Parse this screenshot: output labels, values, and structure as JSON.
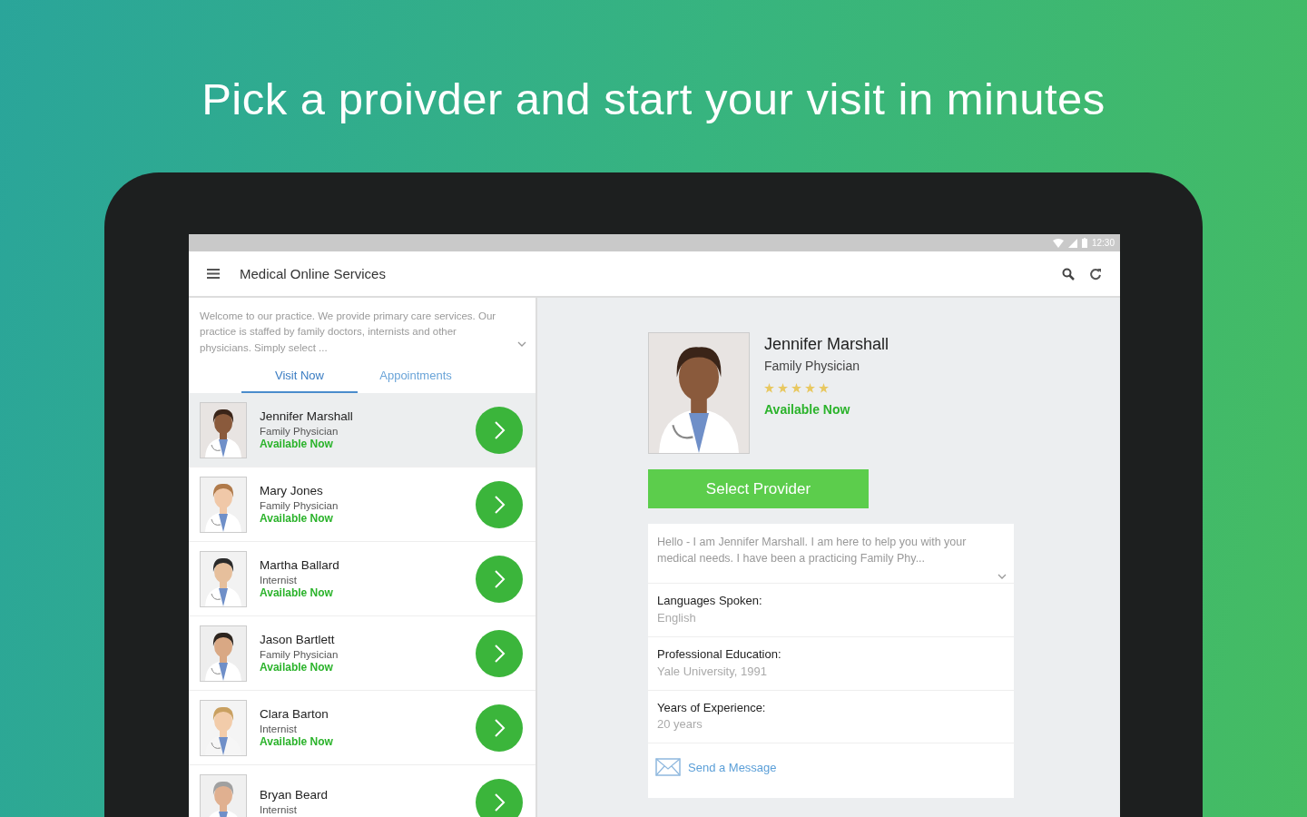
{
  "headline": "Pick a proivder and start your visit in minutes",
  "status_bar": {
    "time": "12:30"
  },
  "app_bar": {
    "title": "Medical Online Services"
  },
  "intro": "Welcome to our practice. We provide primary care services. Our practice is staffed by family doctors, internists and other physicians. Simply select ...",
  "tabs": [
    {
      "label": "Visit Now",
      "selected": true
    },
    {
      "label": "Appointments",
      "selected": false
    }
  ],
  "providers": [
    {
      "name": "Jennifer Marshall",
      "specialty": "Family Physician",
      "status": "Available Now",
      "selected": true
    },
    {
      "name": "Mary Jones",
      "specialty": "Family Physician",
      "status": "Available Now",
      "selected": false
    },
    {
      "name": "Martha Ballard",
      "specialty": "Internist",
      "status": "Available Now",
      "selected": false
    },
    {
      "name": "Jason Bartlett",
      "specialty": "Family Physician",
      "status": "Available Now",
      "selected": false
    },
    {
      "name": "Clara Barton",
      "specialty": "Internist",
      "status": "Available Now",
      "selected": false
    },
    {
      "name": "Bryan Beard",
      "specialty": "Internist",
      "selected": false
    }
  ],
  "detail": {
    "name": "Jennifer Marshall",
    "specialty": "Family Physician",
    "stars": 5,
    "status": "Available Now",
    "select_button": "Select Provider",
    "bio": "Hello - I am Jennifer Marshall. I am here to help you with your medical needs. I have been a practicing Family Phy...",
    "facts": [
      {
        "label": "Languages Spoken:",
        "value": "English"
      },
      {
        "label": "Professional Education:",
        "value": "Yale University, 1991"
      },
      {
        "label": "Years of Experience:",
        "value": "20 years"
      }
    ],
    "message_link": "Send a Message"
  }
}
